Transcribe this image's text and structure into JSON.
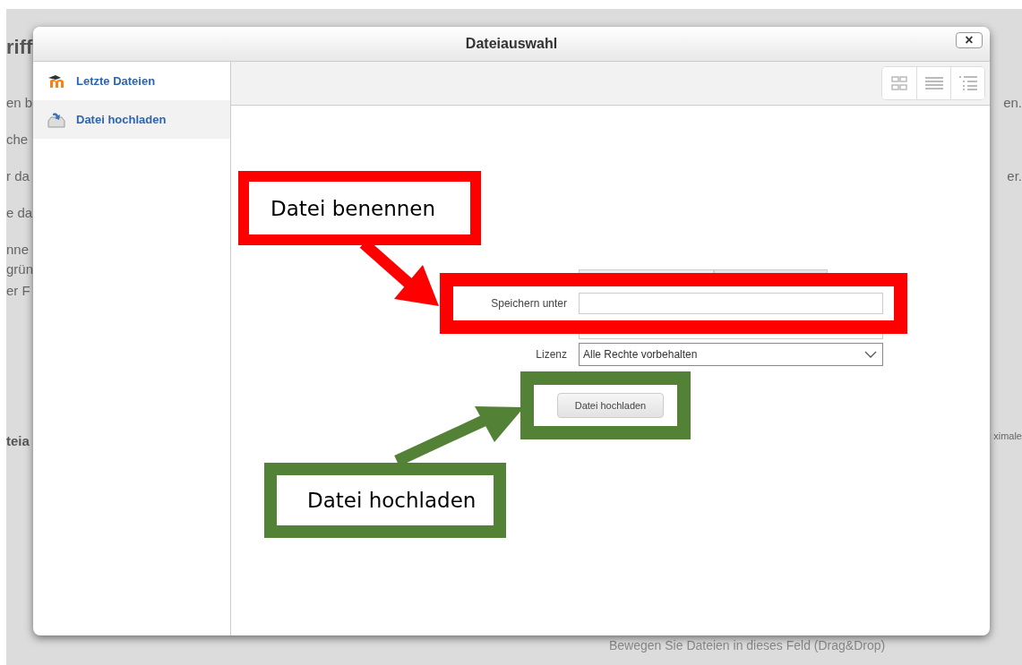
{
  "background": {
    "heading": "riff",
    "left_lines": [
      "en b",
      "che",
      "r da",
      "e da",
      "nne",
      "grün",
      "er F"
    ],
    "section": "teia",
    "right_lines": [
      "en.",
      "er."
    ],
    "right_label": "ximale",
    "dropzone": "Bewegen Sie Dateien in dieses Feld (Drag&Drop)"
  },
  "dialog": {
    "title": "Dateiauswahl",
    "close": "×",
    "sidebar": [
      {
        "label": "Letzte Dateien",
        "kind": "recent",
        "selected": false
      },
      {
        "label": "Datei hochladen",
        "kind": "upload",
        "selected": true
      }
    ],
    "views": [
      {
        "kind": "icons"
      },
      {
        "kind": "list"
      },
      {
        "kind": "tree"
      }
    ],
    "form": [
      {
        "kind": "file"
      },
      {
        "kind": "text",
        "label": "Speichern unter"
      },
      {
        "kind": "text"
      },
      {
        "kind": "select",
        "label": "Lizenz",
        "value": "Alle Rechte vorbehalten"
      }
    ],
    "submit": "Datei hochladen"
  },
  "annotations": [
    {
      "text": "Datei benennen",
      "color": "#ff0000"
    },
    {
      "text": "Datei hochladen",
      "color": "#538135"
    }
  ]
}
